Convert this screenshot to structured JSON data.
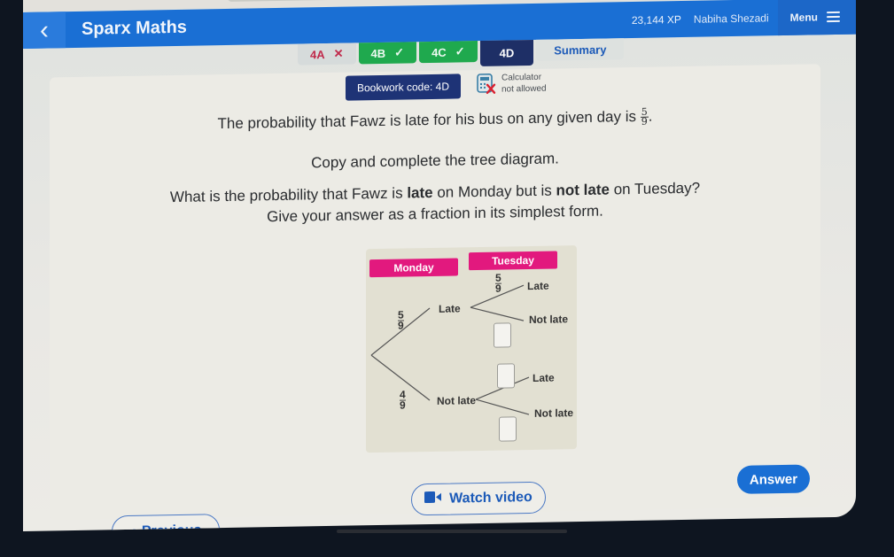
{
  "header": {
    "back_icon": "chevron-left-icon",
    "app_title": "Sparx Maths",
    "xp": "23,144 XP",
    "user_name": "Nabiha Shezadi",
    "menu_label": "Menu",
    "menu_icon": "hamburger-icon"
  },
  "tabs": [
    {
      "label": "4A",
      "status": "incorrect",
      "status_glyph": "✕"
    },
    {
      "label": "4B",
      "status": "correct",
      "status_glyph": "✓"
    },
    {
      "label": "4C",
      "status": "correct",
      "status_glyph": "✓"
    },
    {
      "label": "4D",
      "status": "active"
    },
    {
      "label": "Summary",
      "status": "none"
    }
  ],
  "bookwork": {
    "label": "Bookwork code: 4D",
    "calculator_line1": "Calculator",
    "calculator_line2": "not allowed",
    "calculator_icon": "calculator-not-allowed-icon"
  },
  "question": {
    "line1_text": "The probability that Fawz is late for his bus on any given day is",
    "line1_fraction": {
      "num": "5",
      "den": "9"
    },
    "line1_end": ".",
    "line2": "Copy and complete the tree diagram.",
    "line3_parts": [
      "What is the probability that Fawz is ",
      "late",
      " on Monday but is ",
      "not late",
      " on Tuesday?"
    ],
    "line4": "Give your answer as a fraction in its simplest form."
  },
  "tree": {
    "headers": [
      "Monday",
      "Tuesday"
    ],
    "monday_branches": [
      {
        "label": "Late",
        "prob_num": "5",
        "prob_den": "9"
      },
      {
        "label": "Not late",
        "prob_num": "4",
        "prob_den": "9"
      }
    ],
    "tuesday_after_late": [
      {
        "label": "Late",
        "prob_num": "5",
        "prob_den": "9"
      },
      {
        "label": "Not late",
        "prob": "blank"
      }
    ],
    "tuesday_after_not_late": [
      {
        "label": "Late",
        "prob": "blank"
      },
      {
        "label": "Not late",
        "prob": "blank"
      }
    ]
  },
  "buttons": {
    "answer": "Answer",
    "watch_video": "Watch video",
    "video_icon": "video-camera-icon",
    "previous": "Previous",
    "previous_icon": "chevron-left-icon"
  },
  "colors": {
    "brand_blue": "#1a6fd4",
    "active_tab": "#1e2f66",
    "correct_green": "#1fa94e",
    "incorrect_red": "#c0284a",
    "day_header_pink": "#e2197e"
  }
}
